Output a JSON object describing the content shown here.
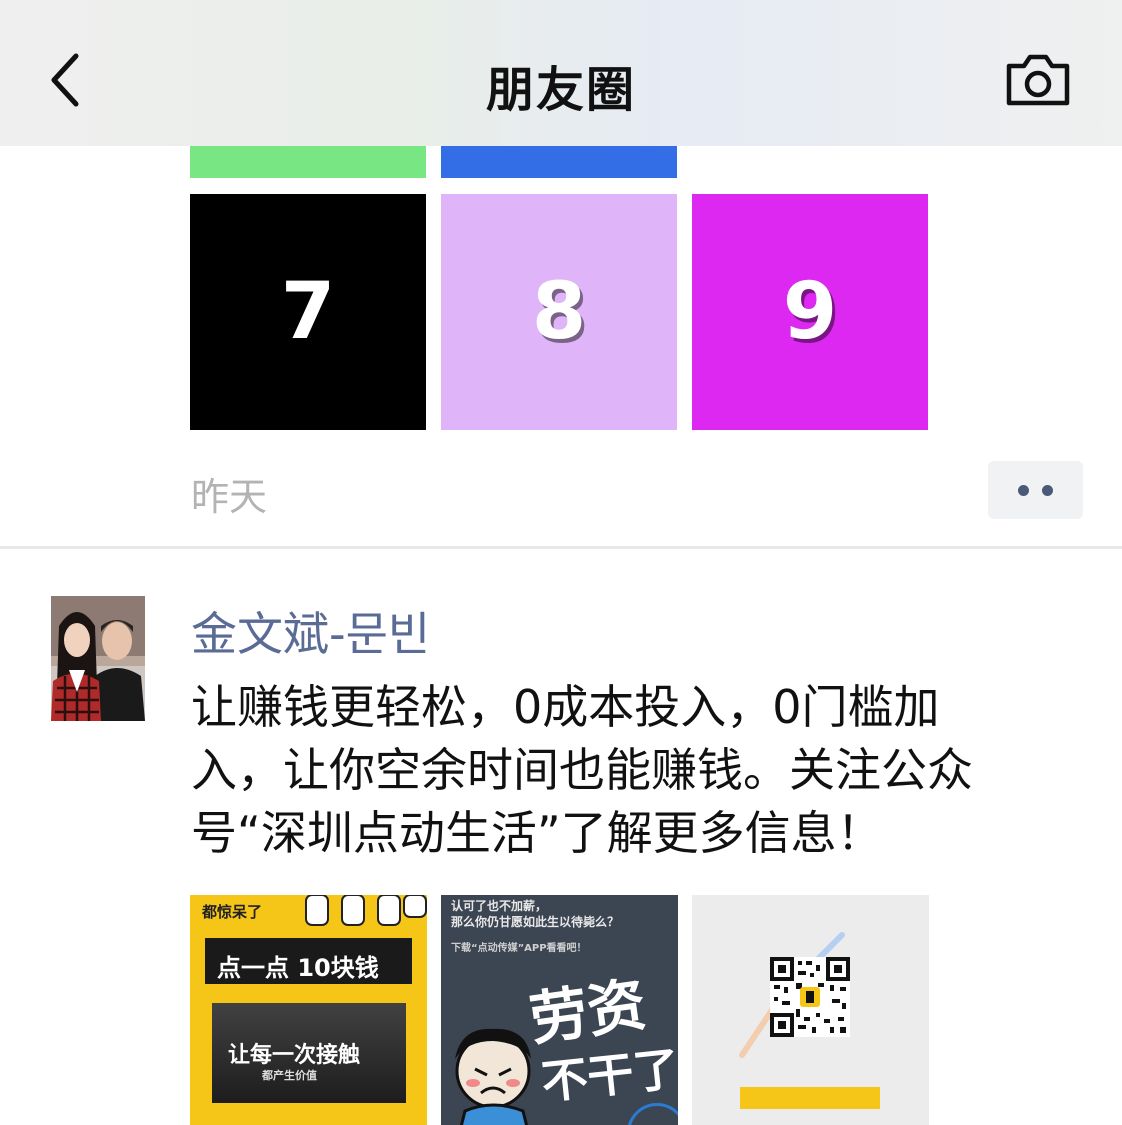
{
  "nav": {
    "title": "朋友圈",
    "back_icon": "chevron-left-icon",
    "camera_icon": "camera-icon"
  },
  "previous_post": {
    "top_tiles_colors": [
      "#78e682",
      "#336ee6"
    ],
    "grid": [
      {
        "label": "7",
        "color": "#000000"
      },
      {
        "label": "8",
        "color": "#e0b4f8"
      },
      {
        "label": "9",
        "color": "#dc28f0"
      }
    ],
    "timestamp": "昨天",
    "more_icon": "more-dots-icon"
  },
  "post": {
    "author": "金文斌-문빈",
    "text_lines": [
      "让赚钱更轻松，0成本投入，0门槛加",
      "入，让你空余时间也能赚钱。关注公众",
      "号“深圳点动生活”了解更多信息！"
    ],
    "images": [
      {
        "header": "都惊呆了",
        "banner": "点一点 10块钱",
        "sub": "让每一次接触",
        "sub2": "都产生价值",
        "accent": "#f5c518"
      },
      {
        "line1": "认可了也不加薪，",
        "line2": "那么你仍甘愿如此生以待毙么？",
        "line3": "下载“点动传媒”APP看看吧！",
        "big1": "劳资",
        "big2": "不干了！"
      },
      {
        "qr_icon": "qr-code-icon"
      }
    ]
  }
}
